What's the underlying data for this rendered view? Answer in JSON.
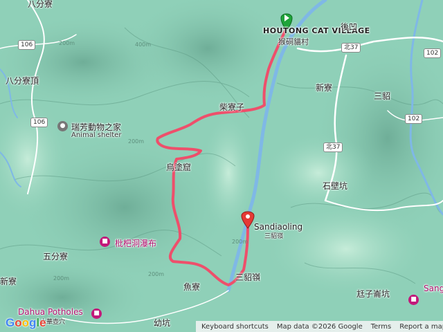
{
  "colors": {
    "route": "#ee4f6b",
    "terrain": "#8fd0b8",
    "river": "#7fb8e6",
    "poi_pink": "#c2187a",
    "start_marker": "#1fa43a"
  },
  "icons": {
    "start": "green-flag-marker-icon",
    "end": "red-pin-marker-icon",
    "attraction": "camera-icon",
    "shelter": "paw-icon"
  },
  "start_place": {
    "name_en": "HOUTONG CAT VILLAGE",
    "name_zh": "猴硐貓村"
  },
  "end_place": {
    "name_en": "Sandiaoling",
    "name_zh": "三貂嶺"
  },
  "pois": {
    "shelter_zh": "瑞芳動物之家",
    "shelter_en": "Animal shelter",
    "waterfall_zh": "枇杷洞瀑布",
    "potholes_en": "Dahua Potholes",
    "potholes_zh": "大華壺穴",
    "right_poi_partial": "Sang"
  },
  "places": {
    "chaiaozi": "柴寮子",
    "wuzhuzuo": "烏塗窟",
    "houao": "後凹",
    "xinliao": "新寮",
    "sandiao": "三貂",
    "shibikeng": "石壁坑",
    "wufenliao": "五分寮",
    "xin_left": "新寮",
    "sandiaoling2": "三貂嶺",
    "yuliao": "魚寮",
    "zhizaimeikeng": "尪子崙坑",
    "youkeng": "幼坑",
    "bafenliaoding": "八分寮頂",
    "bafen_top": "八分寮"
  },
  "roads": [
    "106",
    "106",
    "北37",
    "北37",
    "102",
    "102"
  ],
  "contours": [
    "200m",
    "400m",
    "200m",
    "200m",
    "200m",
    "200m"
  ],
  "footer": {
    "keyboard": "Keyboard shortcuts",
    "mapdata": "Map data ©2026 Google",
    "terms": "Terms",
    "report": "Report a map error"
  },
  "google_logo": [
    "G",
    "o",
    "o",
    "g",
    "l",
    "e"
  ]
}
